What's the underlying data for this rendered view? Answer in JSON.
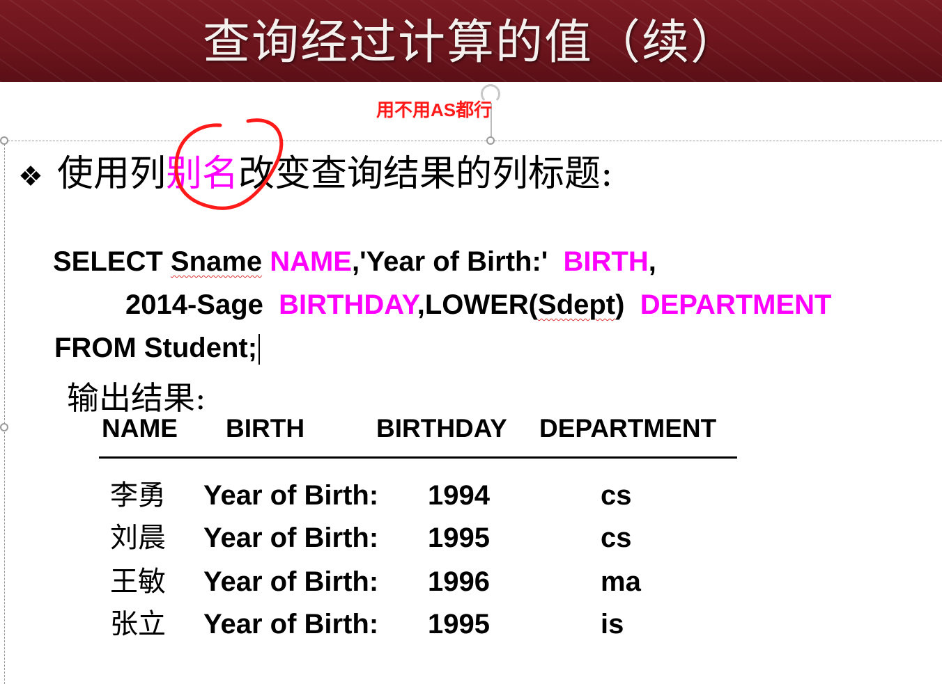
{
  "title": "查询经过计算的值（续）",
  "note": "用不用AS都行",
  "bullet": "❖",
  "heading": {
    "before": "使用列",
    "highlight": "别名",
    "after": "改变查询结果的列标题:"
  },
  "sql": {
    "line1": {
      "a": "SELECT ",
      "b": "Sname",
      "c": " ",
      "d": "NAME",
      "e": ",'Year of Birth:'  ",
      "f": "BIRTH",
      "g": ","
    },
    "line2": {
      "a": "2014-Sage  ",
      "b": "BIRTHDAY",
      "c": ",LOWER(",
      "d": "Sdept",
      "e": ")  ",
      "f": "DEPARTMENT"
    },
    "line3": "FROM Student;"
  },
  "output_label": "输出结果:",
  "table": {
    "headers": [
      "NAME",
      "BIRTH",
      "BIRTHDAY",
      "DEPARTMENT"
    ],
    "rows": [
      [
        "李勇",
        "Year of Birth:",
        "1994",
        "cs"
      ],
      [
        "刘晨",
        "Year of Birth:",
        "1995",
        "cs"
      ],
      [
        "王敏",
        "Year of Birth:",
        "1996",
        "ma"
      ],
      [
        "张立",
        "Year of Birth:",
        "1995",
        "is"
      ]
    ]
  },
  "colors": {
    "title_bar": "#6b141c",
    "highlight": "#ff00ff",
    "annotation_red": "#ff1a1a"
  }
}
